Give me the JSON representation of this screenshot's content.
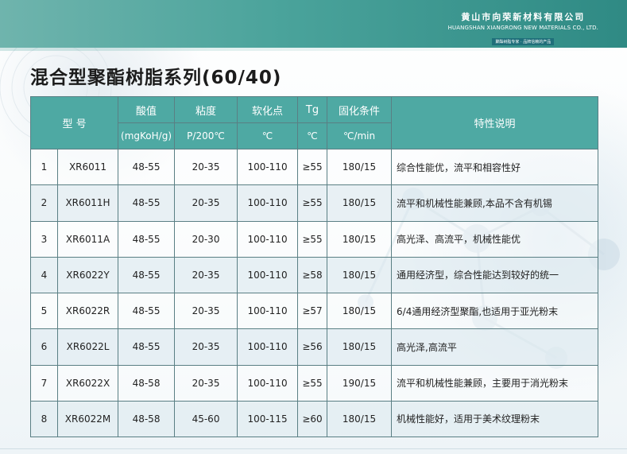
{
  "header": {
    "company_cn": "黄山市向荣新材料有限公司",
    "company_en": "HUANGSHAN XIANGRONG NEW MATERIALS CO., LTD.",
    "company_badge": "聚酯树脂专家 · 品牌信赖的产品",
    "background_color": "#4aa39b"
  },
  "title": "混合型聚酯树脂系列(60/40)",
  "table": {
    "header_color": "#4ea9a3",
    "columns": {
      "model": "型 号",
      "acid_value": "酸值",
      "acid_value_unit": "(mgKoH/g)",
      "viscosity": "粘度",
      "viscosity_unit": "P/200℃",
      "softening_point": "软化点",
      "softening_point_unit": "℃",
      "tg": "Tg",
      "tg_unit": "℃",
      "curing": "固化条件",
      "curing_unit": "℃/min",
      "features": "特性说明"
    },
    "rows": [
      {
        "no": "1",
        "model": "XR6011",
        "acid": "48-55",
        "viscosity": "20-35",
        "softening": "100-110",
        "tg": "≥55",
        "curing": "180/15",
        "features": "综合性能优，流平和相容性好"
      },
      {
        "no": "2",
        "model": "XR6011H",
        "acid": "48-55",
        "viscosity": "20-35",
        "softening": "100-110",
        "tg": "≥55",
        "curing": "180/15",
        "features": "流平和机械性能兼顾,本品不含有机锡"
      },
      {
        "no": "3",
        "model": "XR6011A",
        "acid": "48-55",
        "viscosity": "20-30",
        "softening": "100-110",
        "tg": "≥55",
        "curing": "180/15",
        "features": "高光泽、高流平，机械性能优"
      },
      {
        "no": "4",
        "model": "XR6022Y",
        "acid": "48-55",
        "viscosity": "20-35",
        "softening": "100-110",
        "tg": "≥58",
        "curing": "180/15",
        "features": "通用经济型，综合性能达到较好的统一"
      },
      {
        "no": "5",
        "model": "XR6022R",
        "acid": "48-55",
        "viscosity": "20-35",
        "softening": "100-110",
        "tg": "≥57",
        "curing": "180/15",
        "features": "6/4通用经济型聚酯,也适用于亚光粉末"
      },
      {
        "no": "6",
        "model": "XR6022L",
        "acid": "48-55",
        "viscosity": "20-35",
        "softening": "100-110",
        "tg": "≥56",
        "curing": "180/15",
        "features": "高光泽,高流平"
      },
      {
        "no": "7",
        "model": "XR6022X",
        "acid": "48-58",
        "viscosity": "20-35",
        "softening": "100-110",
        "tg": "≥55",
        "curing": "190/15",
        "features": "流平和机械性能兼顾，主要用于消光粉末"
      },
      {
        "no": "8",
        "model": "XR6022M",
        "acid": "48-58",
        "viscosity": "45-60",
        "softening": "100-115",
        "tg": "≥60",
        "curing": "180/15",
        "features": "机械性能好，适用于美术纹理粉末"
      }
    ]
  }
}
